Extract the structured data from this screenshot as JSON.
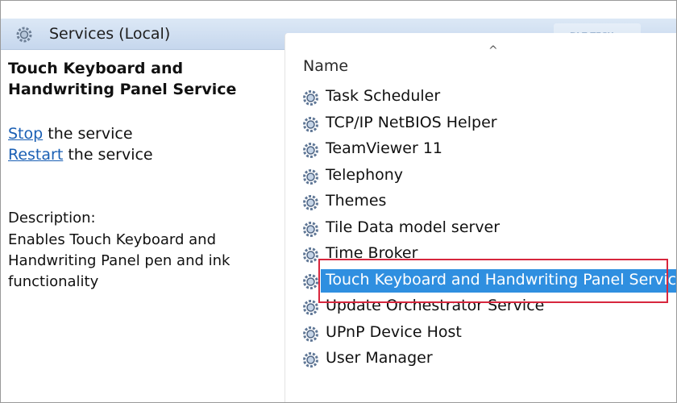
{
  "header": {
    "title": "Services (Local)",
    "icon": "gears-icon",
    "watermark_text": "DLZ TECH"
  },
  "left_pane": {
    "service_title": "Touch Keyboard and Handwriting Panel Service",
    "actions": [
      {
        "link": "Stop",
        "suffix": " the service"
      },
      {
        "link": "Restart",
        "suffix": " the service"
      }
    ],
    "description_label": "Description:",
    "description_text": "Enables Touch Keyboard and Handwriting Panel pen and ink functionality"
  },
  "list": {
    "column_header": "Name",
    "sort_indicator": "^",
    "items": [
      {
        "name": "Task Scheduler",
        "selected": false
      },
      {
        "name": "TCP/IP NetBIOS Helper",
        "selected": false
      },
      {
        "name": "TeamViewer 11",
        "selected": false
      },
      {
        "name": "Telephony",
        "selected": false
      },
      {
        "name": "Themes",
        "selected": false
      },
      {
        "name": "Tile Data model server",
        "selected": false
      },
      {
        "name": "Time Broker",
        "selected": false
      },
      {
        "name": "Touch Keyboard and Handwriting Panel Service",
        "selected": true
      },
      {
        "name": "Update Orchestrator Service",
        "selected": false
      },
      {
        "name": "UPnP Device Host",
        "selected": false
      },
      {
        "name": "User Manager",
        "selected": false
      }
    ]
  },
  "colors": {
    "selection": "#2f8fe0",
    "link": "#1a5fb4",
    "callout": "#d7263d",
    "header_top": "#dce8f6",
    "header_bottom": "#c6d7ed"
  }
}
